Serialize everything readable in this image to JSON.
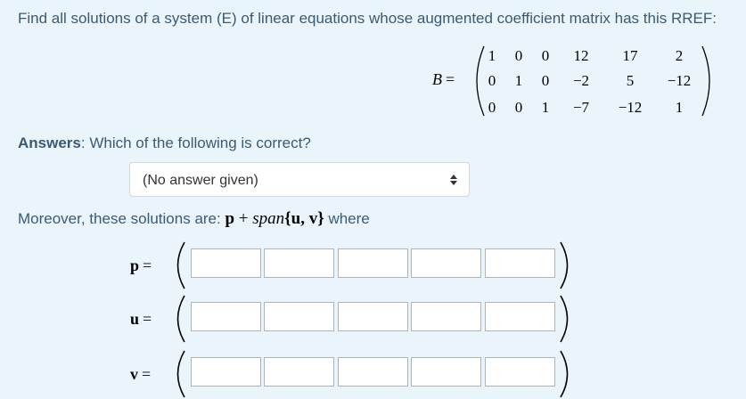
{
  "question": "Find all solutions of a system (E) of linear equations whose augmented coefficient matrix has this RREF:",
  "matrix": {
    "name": "B",
    "eq": "=",
    "rows": [
      [
        "1",
        "0",
        "0",
        "12",
        "17",
        "2"
      ],
      [
        "0",
        "1",
        "0",
        "−2",
        "5",
        "−12"
      ],
      [
        "0",
        "0",
        "1",
        "−7",
        "−12",
        "1"
      ]
    ]
  },
  "answers": {
    "bold_label": "Answers",
    "prompt": ": Which of the following is correct?",
    "select_value": "(No answer given)"
  },
  "moreover": {
    "prefix": "Moreover, these solutions are: ",
    "expr_p": "p",
    "expr_plus": " + ",
    "expr_span": "span",
    "expr_set": "{u, v}",
    "suffix": " where"
  },
  "vectors": [
    {
      "label": "p",
      "eq": "=",
      "cells": [
        "",
        "",
        "",
        "",
        ""
      ]
    },
    {
      "label": "u",
      "eq": "=",
      "cells": [
        "",
        "",
        "",
        "",
        ""
      ]
    },
    {
      "label": "v",
      "eq": "=",
      "cells": [
        "",
        "",
        "",
        "",
        ""
      ]
    }
  ]
}
